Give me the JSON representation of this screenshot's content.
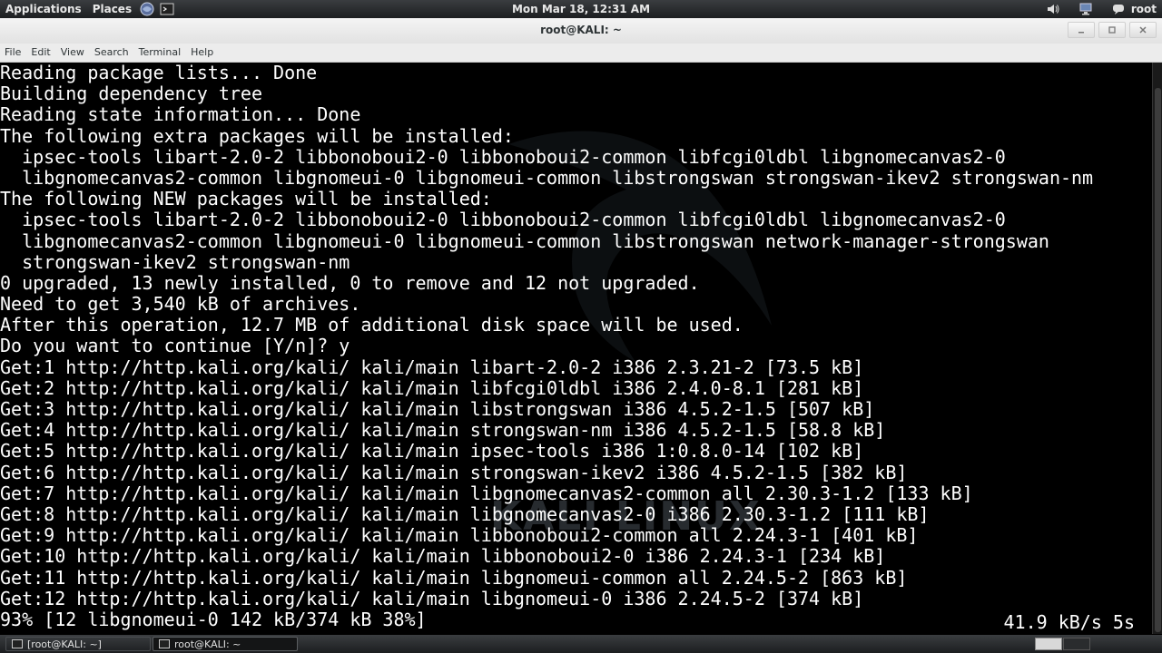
{
  "top_panel": {
    "applications_label": "Applications",
    "places_label": "Places",
    "clock": "Mon Mar 18, 12:31 AM",
    "user_label": "root"
  },
  "window": {
    "title": "root@KALI: ~"
  },
  "menubar": {
    "items": [
      "File",
      "Edit",
      "View",
      "Search",
      "Terminal",
      "Help"
    ]
  },
  "terminal": {
    "lines": [
      "Reading package lists... Done",
      "Building dependency tree",
      "Reading state information... Done",
      "The following extra packages will be installed:",
      "  ipsec-tools libart-2.0-2 libbonoboui2-0 libbonoboui2-common libfcgi0ldbl libgnomecanvas2-0",
      "  libgnomecanvas2-common libgnomeui-0 libgnomeui-common libstrongswan strongswan-ikev2 strongswan-nm",
      "The following NEW packages will be installed:",
      "  ipsec-tools libart-2.0-2 libbonoboui2-0 libbonoboui2-common libfcgi0ldbl libgnomecanvas2-0",
      "  libgnomecanvas2-common libgnomeui-0 libgnomeui-common libstrongswan network-manager-strongswan",
      "  strongswan-ikev2 strongswan-nm",
      "0 upgraded, 13 newly installed, 0 to remove and 12 not upgraded.",
      "Need to get 3,540 kB of archives.",
      "After this operation, 12.7 MB of additional disk space will be used.",
      "Do you want to continue [Y/n]? y",
      "Get:1 http://http.kali.org/kali/ kali/main libart-2.0-2 i386 2.3.21-2 [73.5 kB]",
      "Get:2 http://http.kali.org/kali/ kali/main libfcgi0ldbl i386 2.4.0-8.1 [281 kB]",
      "Get:3 http://http.kali.org/kali/ kali/main libstrongswan i386 4.5.2-1.5 [507 kB]",
      "Get:4 http://http.kali.org/kali/ kali/main strongswan-nm i386 4.5.2-1.5 [58.8 kB]",
      "Get:5 http://http.kali.org/kali/ kali/main ipsec-tools i386 1:0.8.0-14 [102 kB]",
      "Get:6 http://http.kali.org/kali/ kali/main strongswan-ikev2 i386 4.5.2-1.5 [382 kB]",
      "Get:7 http://http.kali.org/kali/ kali/main libgnomecanvas2-common all 2.30.3-1.2 [133 kB]",
      "Get:8 http://http.kali.org/kali/ kali/main libgnomecanvas2-0 i386 2.30.3-1.2 [111 kB]",
      "Get:9 http://http.kali.org/kali/ kali/main libbonoboui2-common all 2.24.3-1 [401 kB]",
      "Get:10 http://http.kali.org/kali/ kali/main libbonoboui2-0 i386 2.24.3-1 [234 kB]",
      "Get:11 http://http.kali.org/kali/ kali/main libgnomeui-common all 2.24.5-2 [863 kB]",
      "Get:12 http://http.kali.org/kali/ kali/main libgnomeui-0 i386 2.24.5-2 [374 kB]",
      "93% [12 libgnomeui-0 142 kB/374 kB 38%]"
    ],
    "status_right": "41.9 kB/s 5s",
    "watermark": "KALI LINUX"
  },
  "taskbar": {
    "tasks": [
      {
        "label": "[root@KALI: ~]"
      },
      {
        "label": "root@KALI: ~"
      }
    ]
  }
}
